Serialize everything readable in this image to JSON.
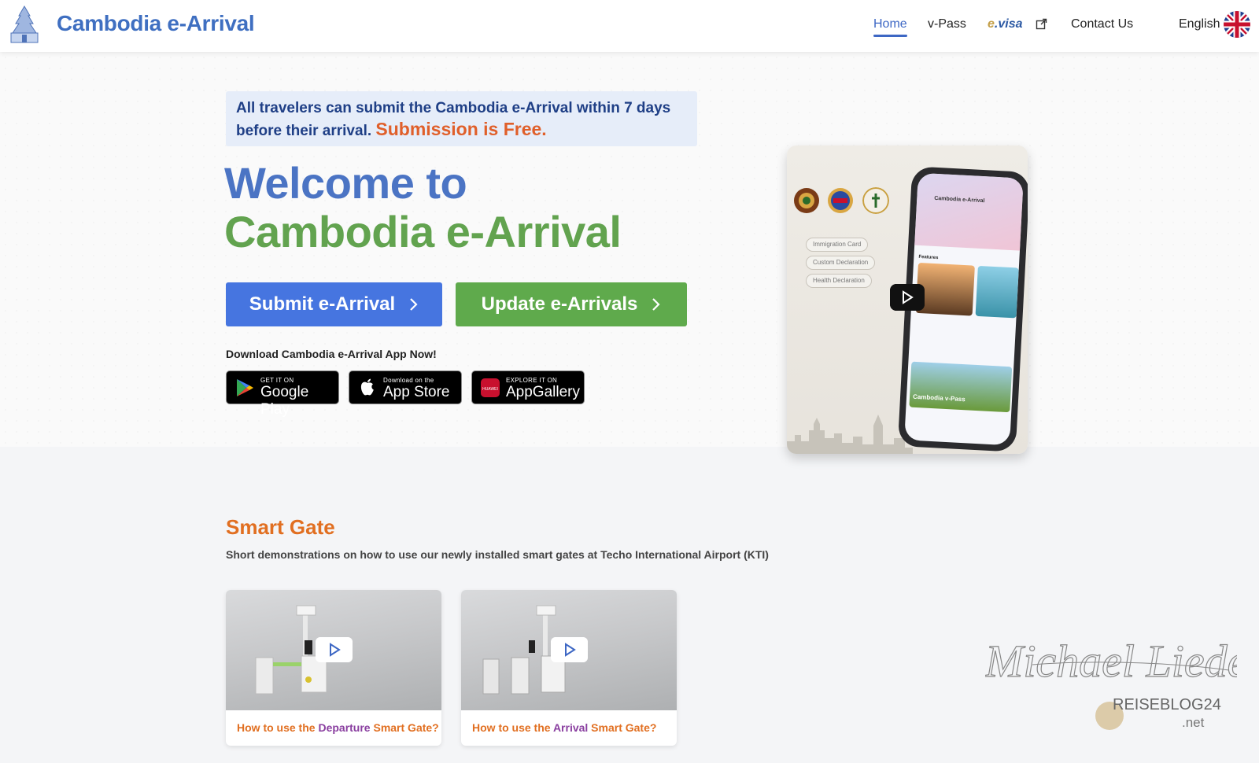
{
  "header": {
    "brand": "Cambodia e-Arrival",
    "nav": {
      "home": "Home",
      "vpass": "v-Pass",
      "evisa_e": "e",
      "evisa_rest": ".visa",
      "contact": "Contact Us"
    },
    "language": "English",
    "accent_color": "#3d67c4"
  },
  "hero": {
    "notice_line": "All travelers can submit the Cambodia e-Arrival within 7 days before their arrival.",
    "notice_free": "Submission is Free.",
    "welcome_line1": "Welcome to",
    "welcome_line2": "Cambodia e-Arrival",
    "submit_button": "Submit e-Arrival",
    "update_button": "Update e-Arrivals",
    "download_label": "Download Cambodia e-Arrival App Now!",
    "stores": [
      {
        "small": "GET IT ON",
        "big": "Google Play",
        "icon": "google-play-icon"
      },
      {
        "small": "Download on the",
        "big": "App Store",
        "icon": "apple-icon"
      },
      {
        "small": "EXPLORE IT ON",
        "big": "AppGallery",
        "icon": "huawei-icon"
      }
    ]
  },
  "promo_video": {
    "pills": [
      "Immigration Card",
      "Custom Declaration",
      "Health Declaration"
    ],
    "app_title": "Cambodia e-Arrival",
    "features_label": "Features",
    "vpass_banner": "Cambodia v-Pass"
  },
  "smart_gate": {
    "title": "Smart Gate",
    "subtitle": "Short demonstrations on how to use our newly installed smart gates at Techo International Airport (KTI)",
    "videos": [
      {
        "caption_pre": "How to use the ",
        "caption_hl": "Departure",
        "caption_post": " Smart Gate?"
      },
      {
        "caption_pre": "How to use the ",
        "caption_hl": "Arrival",
        "caption_post": " Smart Gate?"
      }
    ]
  },
  "watermark": {
    "signature": "Michael Lieder",
    "site": "REISEBLOG24",
    "tld": ".net"
  }
}
